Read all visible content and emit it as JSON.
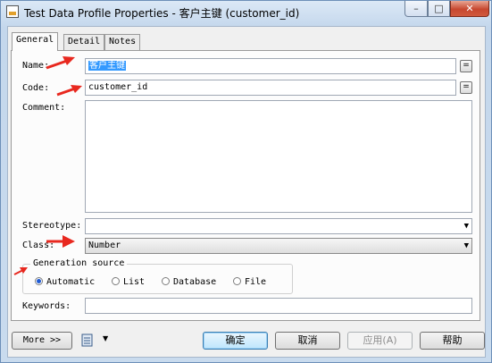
{
  "window": {
    "title": "Test Data Profile Properties - 客户主键 (customer_id)",
    "controls": {
      "minimize": "–",
      "maximize": "□",
      "close": "✕"
    }
  },
  "tabs": [
    {
      "label": "General",
      "active": true
    },
    {
      "label": "Detail",
      "active": false
    },
    {
      "label": "Notes",
      "active": false
    }
  ],
  "form": {
    "name_label": "Name:",
    "name_value": "客户主键",
    "code_label": "Code:",
    "code_value": "customer_id",
    "comment_label": "Comment:",
    "comment_value": "",
    "equals_btn": "=",
    "stereotype_label": "Stereotype:",
    "stereotype_value": "",
    "class_label": "Class:",
    "class_value": "Number",
    "generation_source_label": "Generation source",
    "generation_options": [
      {
        "label": "Automatic",
        "selected": true
      },
      {
        "label": "List",
        "selected": false
      },
      {
        "label": "Database",
        "selected": false
      },
      {
        "label": "File",
        "selected": false
      }
    ],
    "keywords_label": "Keywords:",
    "keywords_value": ""
  },
  "footer": {
    "more_label": "More >>",
    "ok_label": "确定",
    "cancel_label": "取消",
    "apply_label": "应用(A)",
    "help_label": "帮助"
  },
  "icons": {
    "app": "app-icon",
    "tools": "toolbox-icon",
    "dropdown": "chevron-down-icon"
  },
  "colors": {
    "annotation_arrow": "#e8281f",
    "selection": "#3399ff",
    "default_button": "#bee6fd"
  }
}
